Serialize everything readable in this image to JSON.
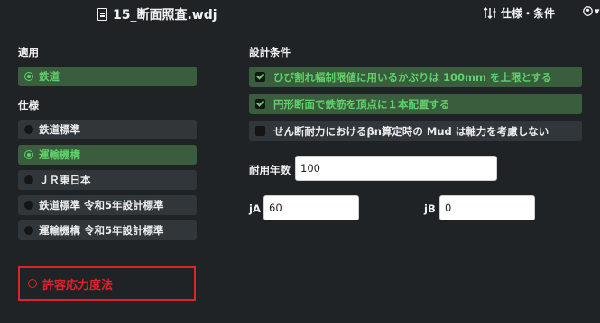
{
  "header": {
    "file_name": "15_断面照査.wdj",
    "spec_label": "仕様・条件",
    "user_caret": "▾"
  },
  "application": {
    "title": "適用",
    "options": [
      {
        "label": "鉄道",
        "selected": true
      }
    ]
  },
  "specification": {
    "title": "仕様",
    "options": [
      {
        "label": "鉄道標準",
        "selected": false
      },
      {
        "label": "運輸機構",
        "selected": true
      },
      {
        "label": "ＪＲ東日本",
        "selected": false
      },
      {
        "label": "鉄道標準 令和5年設計標準",
        "selected": false
      },
      {
        "label": "運輸機構 令和5年設計標準",
        "selected": false
      }
    ]
  },
  "allowable_method": {
    "label": "許容応力度法"
  },
  "design_conditions": {
    "title": "設計条件",
    "checks": [
      {
        "label": "ひび割れ幅制限値に用いるかぶりは 100mm を上限とする",
        "checked": true
      },
      {
        "label": "円形断面で鉄筋を頂点に１本配置する",
        "checked": true
      },
      {
        "label": "せん断耐力におけるβn算定時の Mud は軸力を考慮しない",
        "checked": false
      }
    ]
  },
  "fields": {
    "durability_years": {
      "label": "耐用年数",
      "value": "100"
    },
    "jA": {
      "label": "jA",
      "value": "60"
    },
    "jB": {
      "label": "jB",
      "value": "0"
    }
  },
  "colors": {
    "background": "#202326",
    "row": "#31363b",
    "selected_row": "#3a5e3d",
    "accent_green": "#5fd16b",
    "alert_red": "#e0222d"
  }
}
